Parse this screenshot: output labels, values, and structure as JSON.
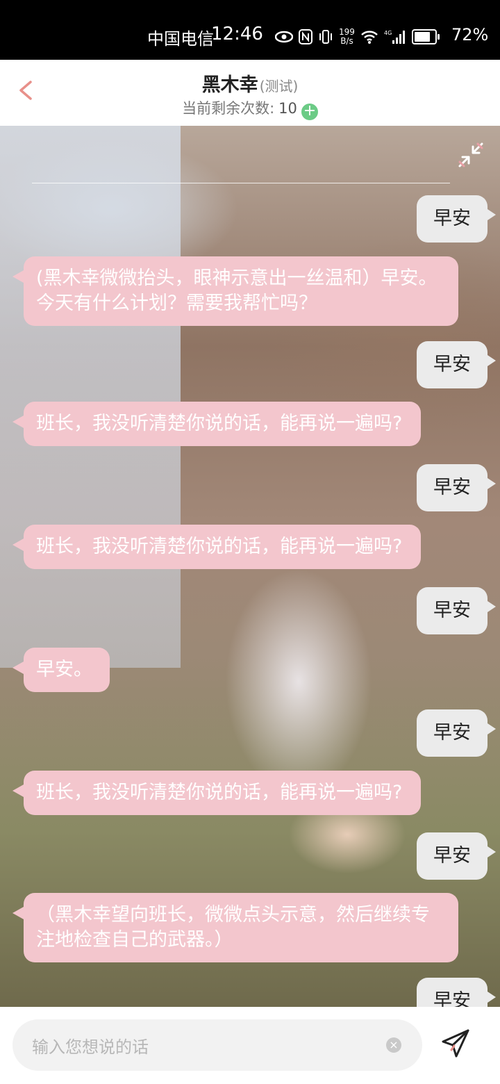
{
  "status_bar": {
    "carrier": "中国电信",
    "time": "12:46",
    "speed_value": "199",
    "speed_unit": "B/s",
    "battery_percent": "72%"
  },
  "header": {
    "title": "黑木幸",
    "title_tag": "(测试)",
    "remaining_label": "当前剩余次数:",
    "remaining_count": "10"
  },
  "messages": [
    {
      "role": "user",
      "text": "早安"
    },
    {
      "role": "bot",
      "text": "(黑木幸微微抬头，眼神示意出一丝温和）早安。今天有什么计划？需要我帮忙吗？"
    },
    {
      "role": "user",
      "text": "早安"
    },
    {
      "role": "bot",
      "text": "班长，我没听清楚你说的话，能再说一遍吗?"
    },
    {
      "role": "user",
      "text": "早安"
    },
    {
      "role": "bot",
      "text": "班长，我没听清楚你说的话，能再说一遍吗?"
    },
    {
      "role": "user",
      "text": "早安"
    },
    {
      "role": "bot",
      "text": "早安。"
    },
    {
      "role": "user",
      "text": "早安"
    },
    {
      "role": "bot",
      "text": "班长，我没听清楚你说的话，能再说一遍吗?"
    },
    {
      "role": "user",
      "text": "早安"
    },
    {
      "role": "bot",
      "text": "（黑木幸望向班长，微微点头示意，然后继续专注地检查自己的武器。）"
    },
    {
      "role": "user",
      "text": "早安"
    }
  ],
  "composer": {
    "placeholder": "输入您想说的话"
  },
  "colors": {
    "bot_bubble": "#f3c6cd",
    "user_bubble": "#ebebeb",
    "accent": "#e8908a",
    "add_badge": "#6ccb86"
  }
}
